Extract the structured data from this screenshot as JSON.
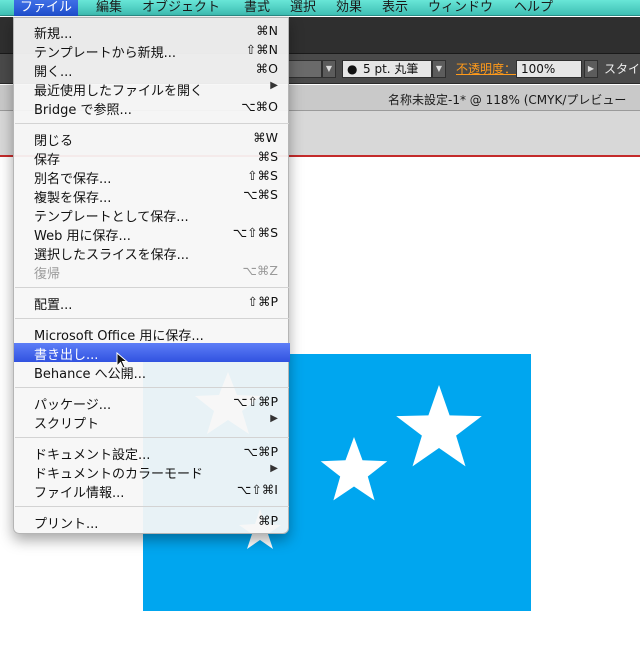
{
  "menubar": {
    "items": [
      "ファイル",
      "編集",
      "オブジェクト",
      "書式",
      "選択",
      "効果",
      "表示",
      "ウィンドウ",
      "ヘルプ"
    ]
  },
  "toolbar": {
    "stroke_label": "5 pt. 丸筆",
    "opacity_label": "不透明度：",
    "opacity_value": "100%",
    "style_label": "スタイ"
  },
  "document": {
    "tab_title": "名称未設定-1* @ 118% (CMYK/プレビュー"
  },
  "menu": {
    "items": [
      {
        "label": "新規...",
        "shortcut": "⌘N"
      },
      {
        "label": "テンプレートから新規...",
        "shortcut": "⇧⌘N"
      },
      {
        "label": "開く...",
        "shortcut": "⌘O"
      },
      {
        "label": "最近使用したファイルを開く",
        "shortcut": "▶"
      },
      {
        "label": "Bridge で参照...",
        "shortcut": "⌥⌘O"
      },
      {
        "label": "閉じる",
        "shortcut": "⌘W"
      },
      {
        "label": "保存",
        "shortcut": "⌘S"
      },
      {
        "label": "別名で保存...",
        "shortcut": "⇧⌘S"
      },
      {
        "label": "複製を保存...",
        "shortcut": "⌥⌘S"
      },
      {
        "label": "テンプレートとして保存...",
        "shortcut": ""
      },
      {
        "label": "Web 用に保存...",
        "shortcut": "⌥⇧⌘S"
      },
      {
        "label": "選択したスライスを保存...",
        "shortcut": ""
      },
      {
        "label": "復帰",
        "shortcut": "⌥⌘Z"
      },
      {
        "label": "配置...",
        "shortcut": "⇧⌘P"
      },
      {
        "label": "Microsoft Office 用に保存...",
        "shortcut": ""
      },
      {
        "label": "書き出し...",
        "shortcut": ""
      },
      {
        "label": "Behance へ公開...",
        "shortcut": ""
      },
      {
        "label": "パッケージ...",
        "shortcut": "⌥⇧⌘P"
      },
      {
        "label": "スクリプト",
        "shortcut": "▶"
      },
      {
        "label": "ドキュメント設定...",
        "shortcut": "⌥⌘P"
      },
      {
        "label": "ドキュメントのカラーモード",
        "shortcut": "▶"
      },
      {
        "label": "ファイル情報...",
        "shortcut": "⌥⇧⌘I"
      },
      {
        "label": "プリント...",
        "shortcut": "⌘P"
      }
    ]
  },
  "colors": {
    "menubar": "#4fd3c6",
    "highlight": "#3f5fe8",
    "artboard": "#00a6ef",
    "opacity_label": "#ff9a1a"
  }
}
